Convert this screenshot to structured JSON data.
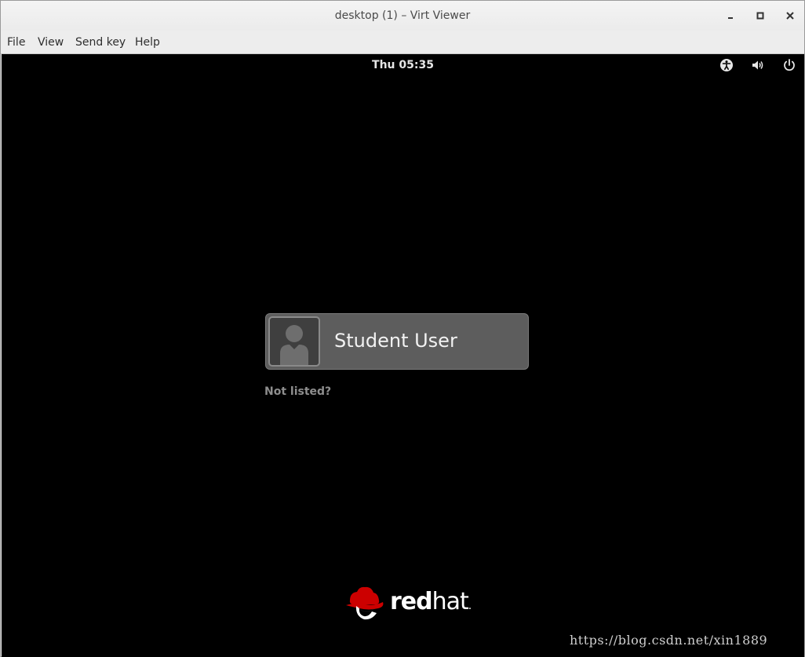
{
  "window": {
    "title": "desktop (1) – Virt Viewer"
  },
  "menubar": {
    "items": [
      {
        "label": "File"
      },
      {
        "label": "View"
      },
      {
        "label": "Send key"
      },
      {
        "label": "Help"
      }
    ]
  },
  "topbar": {
    "clock": "Thu 05:35",
    "icons": [
      "accessibility-icon",
      "volume-icon",
      "power-icon"
    ]
  },
  "login": {
    "user_name": "Student User",
    "not_listed_label": "Not listed?"
  },
  "branding": {
    "logo_red": "red",
    "logo_hat": "hat",
    "logo_dot": ".",
    "accent": "#cc0000"
  },
  "watermark": {
    "text": "https://blog.csdn.net/xin1889"
  }
}
